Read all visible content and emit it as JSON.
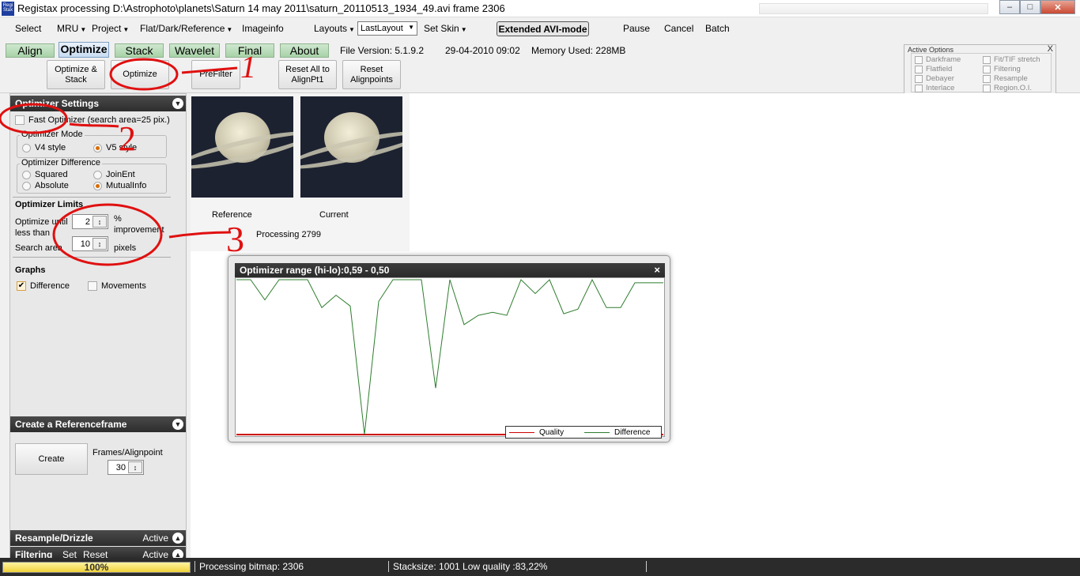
{
  "window": {
    "title": "Registax processing D:\\Astrophoto\\planets\\Saturn 14 may 2011\\saturn_20110513_1934_49.avi frame 2306",
    "icon_text": "Regi Stax"
  },
  "menu": {
    "select": "Select",
    "mru": "MRU",
    "project": "Project",
    "flat_dark": "Flat/Dark/Reference",
    "imageinfo": "Imageinfo",
    "layouts": "Layouts",
    "layout_value": "LastLayout",
    "set_skin": "Set Skin",
    "extended_avi": "Extended AVI-mode",
    "pause": "Pause",
    "cancel": "Cancel",
    "batch": "Batch"
  },
  "tabs": {
    "align": "Align",
    "optimize": "Optimize",
    "stack": "Stack",
    "wavelet": "Wavelet",
    "final": "Final",
    "about": "About",
    "file_version": "File Version: 5.1.9.2",
    "date": "29-04-2010 09:02",
    "memory": "Memory Used: 228MB"
  },
  "toolbar": {
    "optimize_stack": "Optimize & Stack",
    "optimize": "Optimize",
    "prefilter": "PreFilter",
    "reset_all": "Reset All to AlignPt1",
    "reset_alignpoints": "Reset Alignpoints"
  },
  "active_options": {
    "title": "Active Options",
    "close": "X",
    "darkframe": "Darkframe",
    "flatfield": "Flatfield",
    "debayer": "Debayer",
    "interlace": "Interlace",
    "fit_tif": "Fit/TIF stretch",
    "filtering": "Filtering",
    "resample": "Resample",
    "region": "Region.O.I."
  },
  "optimizer_settings": {
    "header": "Optimizer Settings",
    "fast_optimizer": "Fast Optimizer (search area=25 pix.)",
    "mode_label": "Optimizer Mode",
    "v4": "V4 style",
    "v5": "V5 style",
    "diff_label": "Optimizer Difference",
    "squared": "Squared",
    "joinent": "JoinEnt",
    "absolute": "Absolute",
    "mutualinfo": "MutualInfo",
    "limits_header": "Optimizer Limits",
    "optimize_until": "Optimize until",
    "less_than": "less than",
    "until_value": "2",
    "percent": "%",
    "improvement": "improvement",
    "search_area": "Search area",
    "search_value": "10",
    "pixels": "pixels",
    "graphs_header": "Graphs",
    "difference": "Difference",
    "movements": "Movements"
  },
  "reference_frame": {
    "header": "Create a Referenceframe",
    "create": "Create",
    "frames_label": "Frames/Alignpoint",
    "frames_value": "30"
  },
  "bottom_panels": {
    "resample": "Resample/Drizzle",
    "resample_status": "Active",
    "filtering": "Filtering",
    "set": "Set",
    "reset": "Reset",
    "filtering_status": "Active"
  },
  "preview": {
    "reference_label": "Reference",
    "current_label": "Current",
    "processing": "Processing 2799"
  },
  "optimizer_window": {
    "title": "Optimizer range (hi-lo):0,59 - 0,50",
    "close": "×",
    "legend_quality": "Quality",
    "legend_difference": "Difference"
  },
  "chart_data": {
    "type": "line",
    "title": "Optimizer range (hi-lo):0,59 - 0,50",
    "xlabel": "",
    "ylabel": "",
    "ylim": [
      0,
      1
    ],
    "legend_position": "bottom-right",
    "series": [
      {
        "name": "Quality",
        "color": "#cc0000",
        "values": [
          0,
          0,
          0,
          0,
          0,
          0,
          0,
          0,
          0,
          0,
          0,
          0,
          0,
          0,
          0,
          0,
          0,
          0,
          0,
          0,
          0,
          0,
          0,
          0,
          0,
          0,
          0,
          0,
          0,
          0,
          0
        ]
      },
      {
        "name": "Difference",
        "color": "#2e7d2e",
        "values": [
          1.0,
          1.0,
          0.87,
          1.0,
          1.0,
          1.0,
          0.82,
          0.9,
          0.83,
          0.0,
          0.86,
          1.0,
          1.0,
          1.0,
          0.3,
          1.0,
          0.71,
          0.77,
          0.79,
          0.77,
          1.0,
          0.91,
          1.0,
          0.78,
          0.81,
          1.0,
          0.82,
          0.82,
          0.98,
          0.98,
          0.98
        ]
      }
    ]
  },
  "annotations": {
    "one": "1",
    "two": "2",
    "three": "3"
  },
  "status": {
    "progress": 1.0,
    "progress_text": "100%",
    "processing_bitmap": "Processing bitmap: 2306",
    "stacksize": "Stacksize: 1001 Low quality :83,22%"
  }
}
